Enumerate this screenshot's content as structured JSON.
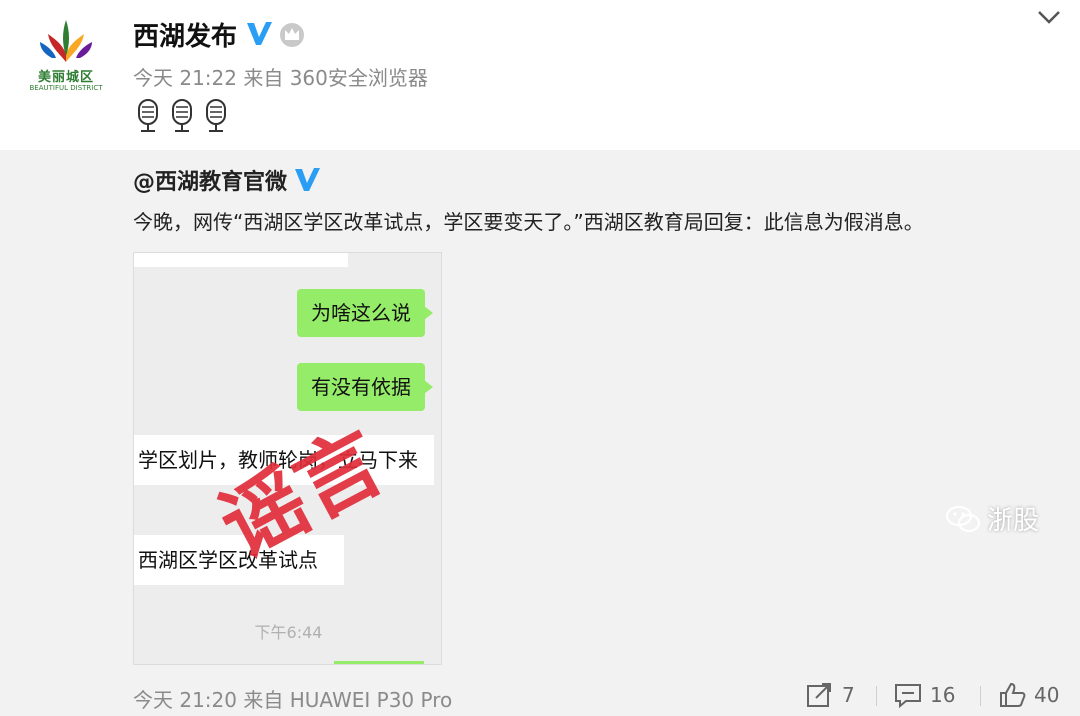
{
  "post": {
    "author": "西湖发布",
    "meta": "今天 21:22 来自 360安全浏览器",
    "avatar": {
      "logo_text": "美丽城区",
      "logo_sub": "BEAUTIFUL DISTRICT"
    },
    "emojis": [
      "microphone-icon",
      "microphone-icon",
      "microphone-icon"
    ]
  },
  "repost": {
    "author": "@西湖教育官微",
    "text": "今晚，网传“西湖区学区改革试点，学区要变天了。”西湖区教育局回复：此信息为假消息。",
    "screenshot": {
      "bubble_1": "为啥这么说",
      "bubble_2": "有没有依据",
      "msg_1": "学区划片，教师轮岗，立马下来",
      "msg_2": "西湖区学区改革试点",
      "time": "下午6:44",
      "stamp": "谣言"
    },
    "meta": "今天 21:20 来自 HUAWEI P30 Pro",
    "actions": {
      "repost_count": "7",
      "comment_count": "16",
      "like_count": "40"
    }
  },
  "watermark": "浙股",
  "colors": {
    "verified_blue": "#2a9df4",
    "wechat_green": "#95ec69",
    "stamp_red": "#e02d3a"
  }
}
